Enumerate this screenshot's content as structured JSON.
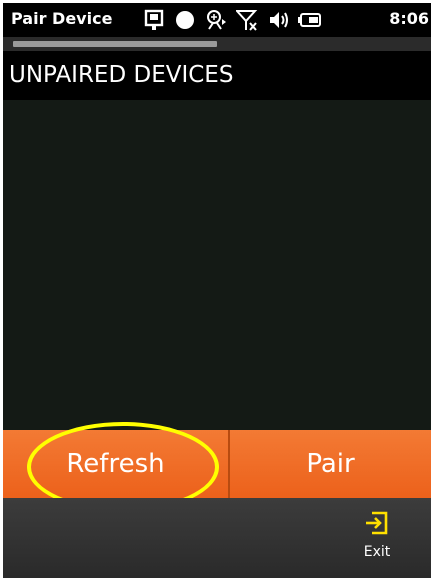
{
  "status_bar": {
    "app_title": "Pair Device",
    "time": "8:06",
    "icons": [
      "device-icon",
      "record-dot-icon",
      "bluetooth-search-icon",
      "no-signal-icon",
      "volume-icon",
      "battery-icon"
    ]
  },
  "header": {
    "title": "UNPAIRED DEVICES"
  },
  "device_list": {
    "items": []
  },
  "actions": {
    "refresh_label": "Refresh",
    "pair_label": "Pair"
  },
  "bottom_bar": {
    "exit_label": "Exit"
  },
  "progress": {
    "value": 0.5
  },
  "colors": {
    "accent": "#f06b22",
    "highlight": "#ffff00",
    "list_background": "#141a15"
  }
}
